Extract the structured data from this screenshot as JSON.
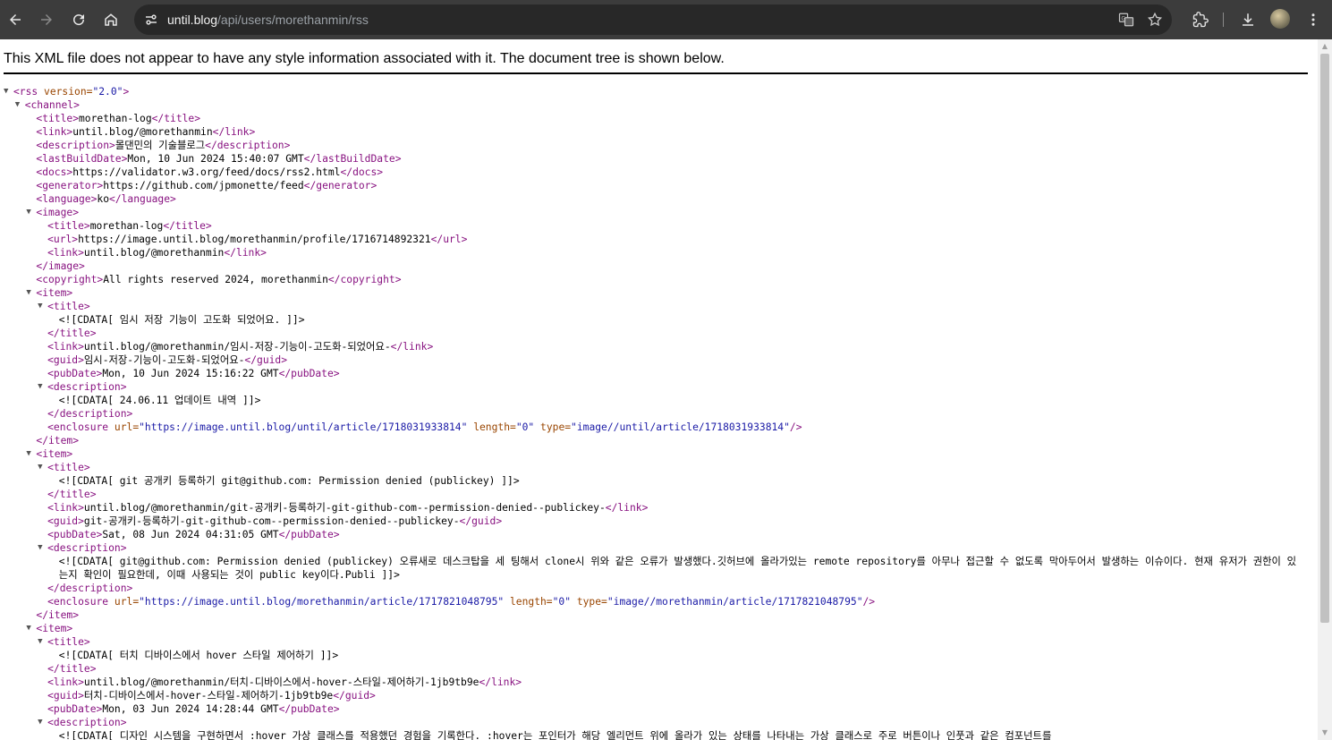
{
  "browser": {
    "url_host": "until.blog",
    "url_path": "/api/users/morethanmin/rss"
  },
  "infobar_text": "This XML file does not appear to have any style information associated with it. The document tree is shown below.",
  "xml_lines": [
    {
      "i": 0,
      "t": 1,
      "p": [
        [
          "t",
          "<rss"
        ],
        [
          "a",
          " version="
        ],
        [
          "v",
          "\"2.0\""
        ],
        [
          "t",
          ">"
        ]
      ]
    },
    {
      "i": 1,
      "t": 1,
      "p": [
        [
          "t",
          "<channel>"
        ]
      ]
    },
    {
      "i": 2,
      "p": [
        [
          "t",
          "<title>"
        ],
        [
          "x",
          "morethan-log"
        ],
        [
          "t",
          "</title>"
        ]
      ]
    },
    {
      "i": 2,
      "p": [
        [
          "t",
          "<link>"
        ],
        [
          "x",
          "until.blog/@morethanmin"
        ],
        [
          "t",
          "</link>"
        ]
      ]
    },
    {
      "i": 2,
      "p": [
        [
          "t",
          "<description>"
        ],
        [
          "x",
          "몰댄민의 기술블로그"
        ],
        [
          "t",
          "</description>"
        ]
      ]
    },
    {
      "i": 2,
      "p": [
        [
          "t",
          "<lastBuildDate>"
        ],
        [
          "x",
          "Mon, 10 Jun 2024 15:40:07 GMT"
        ],
        [
          "t",
          "</lastBuildDate>"
        ]
      ]
    },
    {
      "i": 2,
      "p": [
        [
          "t",
          "<docs>"
        ],
        [
          "x",
          "https://validator.w3.org/feed/docs/rss2.html"
        ],
        [
          "t",
          "</docs>"
        ]
      ]
    },
    {
      "i": 2,
      "p": [
        [
          "t",
          "<generator>"
        ],
        [
          "x",
          "https://github.com/jpmonette/feed"
        ],
        [
          "t",
          "</generator>"
        ]
      ]
    },
    {
      "i": 2,
      "p": [
        [
          "t",
          "<language>"
        ],
        [
          "x",
          "ko"
        ],
        [
          "t",
          "</language>"
        ]
      ]
    },
    {
      "i": 2,
      "t": 1,
      "p": [
        [
          "t",
          "<image>"
        ]
      ]
    },
    {
      "i": 3,
      "p": [
        [
          "t",
          "<title>"
        ],
        [
          "x",
          "morethan-log"
        ],
        [
          "t",
          "</title>"
        ]
      ]
    },
    {
      "i": 3,
      "p": [
        [
          "t",
          "<url>"
        ],
        [
          "x",
          "https://image.until.blog/morethanmin/profile/1716714892321"
        ],
        [
          "t",
          "</url>"
        ]
      ]
    },
    {
      "i": 3,
      "p": [
        [
          "t",
          "<link>"
        ],
        [
          "x",
          "until.blog/@morethanmin"
        ],
        [
          "t",
          "</link>"
        ]
      ]
    },
    {
      "i": 2,
      "p": [
        [
          "t",
          "</image>"
        ]
      ]
    },
    {
      "i": 2,
      "p": [
        [
          "t",
          "<copyright>"
        ],
        [
          "x",
          "All rights reserved 2024, morethanmin"
        ],
        [
          "t",
          "</copyright>"
        ]
      ]
    },
    {
      "i": 2,
      "t": 1,
      "p": [
        [
          "t",
          "<item>"
        ]
      ]
    },
    {
      "i": 3,
      "t": 1,
      "p": [
        [
          "t",
          "<title>"
        ]
      ]
    },
    {
      "i": 4,
      "p": [
        [
          "x",
          "<![CDATA[ 임시 저장 기능이 고도화 되었어요. ]]>"
        ]
      ]
    },
    {
      "i": 3,
      "p": [
        [
          "t",
          "</title>"
        ]
      ]
    },
    {
      "i": 3,
      "p": [
        [
          "t",
          "<link>"
        ],
        [
          "x",
          "until.blog/@morethanmin/임시-저장-기능이-고도화-되었어요-"
        ],
        [
          "t",
          "</link>"
        ]
      ]
    },
    {
      "i": 3,
      "p": [
        [
          "t",
          "<guid>"
        ],
        [
          "x",
          "임시-저장-기능이-고도화-되었어요-"
        ],
        [
          "t",
          "</guid>"
        ]
      ]
    },
    {
      "i": 3,
      "p": [
        [
          "t",
          "<pubDate>"
        ],
        [
          "x",
          "Mon, 10 Jun 2024 15:16:22 GMT"
        ],
        [
          "t",
          "</pubDate>"
        ]
      ]
    },
    {
      "i": 3,
      "t": 1,
      "p": [
        [
          "t",
          "<description>"
        ]
      ]
    },
    {
      "i": 4,
      "p": [
        [
          "x",
          "<![CDATA[ 24.06.11 업데이트 내역 ]]>"
        ]
      ]
    },
    {
      "i": 3,
      "p": [
        [
          "t",
          "</description>"
        ]
      ]
    },
    {
      "i": 3,
      "p": [
        [
          "t",
          "<enclosure"
        ],
        [
          "a",
          " url="
        ],
        [
          "v",
          "\"https://image.until.blog/until/article/1718031933814\""
        ],
        [
          "a",
          " length="
        ],
        [
          "v",
          "\"0\""
        ],
        [
          "a",
          " type="
        ],
        [
          "v",
          "\"image//until/article/1718031933814\""
        ],
        [
          "t",
          "/>"
        ]
      ]
    },
    {
      "i": 2,
      "p": [
        [
          "t",
          "</item>"
        ]
      ]
    },
    {
      "i": 2,
      "t": 1,
      "p": [
        [
          "t",
          "<item>"
        ]
      ]
    },
    {
      "i": 3,
      "t": 1,
      "p": [
        [
          "t",
          "<title>"
        ]
      ]
    },
    {
      "i": 4,
      "p": [
        [
          "x",
          "<![CDATA[ git 공개키 등록하기 git@github.com: Permission denied (publickey) ]]>"
        ]
      ]
    },
    {
      "i": 3,
      "p": [
        [
          "t",
          "</title>"
        ]
      ]
    },
    {
      "i": 3,
      "p": [
        [
          "t",
          "<link>"
        ],
        [
          "x",
          "until.blog/@morethanmin/git-공개키-등록하기-git-github-com--permission-denied--publickey-"
        ],
        [
          "t",
          "</link>"
        ]
      ]
    },
    {
      "i": 3,
      "p": [
        [
          "t",
          "<guid>"
        ],
        [
          "x",
          "git-공개키-등록하기-git-github-com--permission-denied--publickey-"
        ],
        [
          "t",
          "</guid>"
        ]
      ]
    },
    {
      "i": 3,
      "p": [
        [
          "t",
          "<pubDate>"
        ],
        [
          "x",
          "Sat, 08 Jun 2024 04:31:05 GMT"
        ],
        [
          "t",
          "</pubDate>"
        ]
      ]
    },
    {
      "i": 3,
      "t": 1,
      "p": [
        [
          "t",
          "<description>"
        ]
      ]
    },
    {
      "i": 4,
      "w": 1,
      "p": [
        [
          "x",
          "<![CDATA[ git@github.com: Permission denied (publickey) 오류새로 데스크탑을 세 팅해서 clone시 위와 같은 오류가 발생했다.깃허브에 올라가있는 remote repository를 아무나 접근할 수 없도록 막아두어서 발생하는 이슈이다. 현재 유저가 권한이 있는지 확인이 필요한데, 이때 사용되는 것이 public key이다.Publi ]]>"
        ]
      ]
    },
    {
      "i": 3,
      "p": [
        [
          "t",
          "</description>"
        ]
      ]
    },
    {
      "i": 3,
      "p": [
        [
          "t",
          "<enclosure"
        ],
        [
          "a",
          " url="
        ],
        [
          "v",
          "\"https://image.until.blog/morethanmin/article/1717821048795\""
        ],
        [
          "a",
          " length="
        ],
        [
          "v",
          "\"0\""
        ],
        [
          "a",
          " type="
        ],
        [
          "v",
          "\"image//morethanmin/article/1717821048795\""
        ],
        [
          "t",
          "/>"
        ]
      ]
    },
    {
      "i": 2,
      "p": [
        [
          "t",
          "</item>"
        ]
      ]
    },
    {
      "i": 2,
      "t": 1,
      "p": [
        [
          "t",
          "<item>"
        ]
      ]
    },
    {
      "i": 3,
      "t": 1,
      "p": [
        [
          "t",
          "<title>"
        ]
      ]
    },
    {
      "i": 4,
      "p": [
        [
          "x",
          "<![CDATA[ 터치 디바이스에서 hover 스타일 제어하기 ]]>"
        ]
      ]
    },
    {
      "i": 3,
      "p": [
        [
          "t",
          "</title>"
        ]
      ]
    },
    {
      "i": 3,
      "p": [
        [
          "t",
          "<link>"
        ],
        [
          "x",
          "until.blog/@morethanmin/터치-디바이스에서-hover-스타일-제어하기-1jb9tb9e"
        ],
        [
          "t",
          "</link>"
        ]
      ]
    },
    {
      "i": 3,
      "p": [
        [
          "t",
          "<guid>"
        ],
        [
          "x",
          "터치-디바이스에서-hover-스타일-제어하기-1jb9tb9e"
        ],
        [
          "t",
          "</guid>"
        ]
      ]
    },
    {
      "i": 3,
      "p": [
        [
          "t",
          "<pubDate>"
        ],
        [
          "x",
          "Mon, 03 Jun 2024 14:28:44 GMT"
        ],
        [
          "t",
          "</pubDate>"
        ]
      ]
    },
    {
      "i": 3,
      "t": 1,
      "p": [
        [
          "t",
          "<description>"
        ]
      ]
    },
    {
      "i": 4,
      "p": [
        [
          "x",
          "<![CDATA[ 디자인 시스템을 구현하면서 :hover 가상 클래스를 적용했던 경험을 기록한다. :hover는 포인터가 해당 엘리먼트 위에 올라가 있는 상태를 나타내는 가상 클래스로 주로 버튼이나 인풋과 같은 컴포넌트를"
        ]
      ]
    }
  ]
}
